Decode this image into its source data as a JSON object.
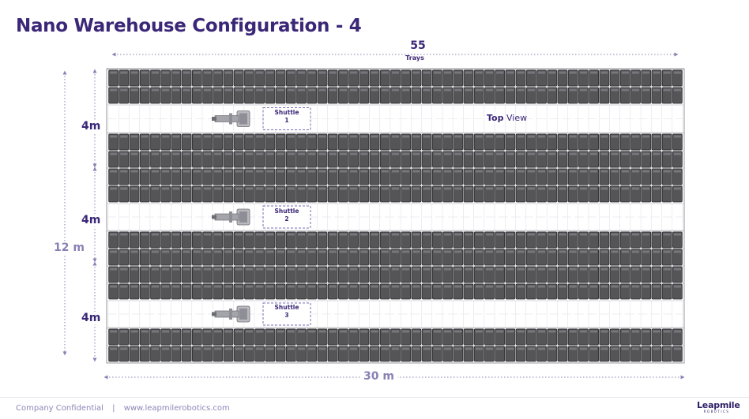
{
  "page": {
    "title": "Nano Warehouse Configuration - 4"
  },
  "dimensions": {
    "trays_count": "55",
    "trays_label": "Trays",
    "aisle_height_1": "4m",
    "aisle_height_2": "4m",
    "aisle_height_3": "4m",
    "total_height": "12 m",
    "total_width": "30 m"
  },
  "view_label": {
    "bold": "Top",
    "rest": " View"
  },
  "shuttles": [
    {
      "label": "Shuttle",
      "number": "1"
    },
    {
      "label": "Shuttle",
      "number": "2"
    },
    {
      "label": "Shuttle",
      "number": "3"
    }
  ],
  "footer": {
    "confidential": "Company Confidential",
    "separator": "|",
    "website": "www.leapmilerobotics.com"
  },
  "logo": {
    "word": "Leapmile",
    "sub": "ROBOTICS"
  },
  "colors": {
    "brand": "#3b2777",
    "dimension_line": "#8a80b5",
    "tray": "#555558",
    "tray_edge": "#2a2a2c",
    "grid_line": "#c9c9cf",
    "shuttle_box": "#7a6fb3"
  }
}
